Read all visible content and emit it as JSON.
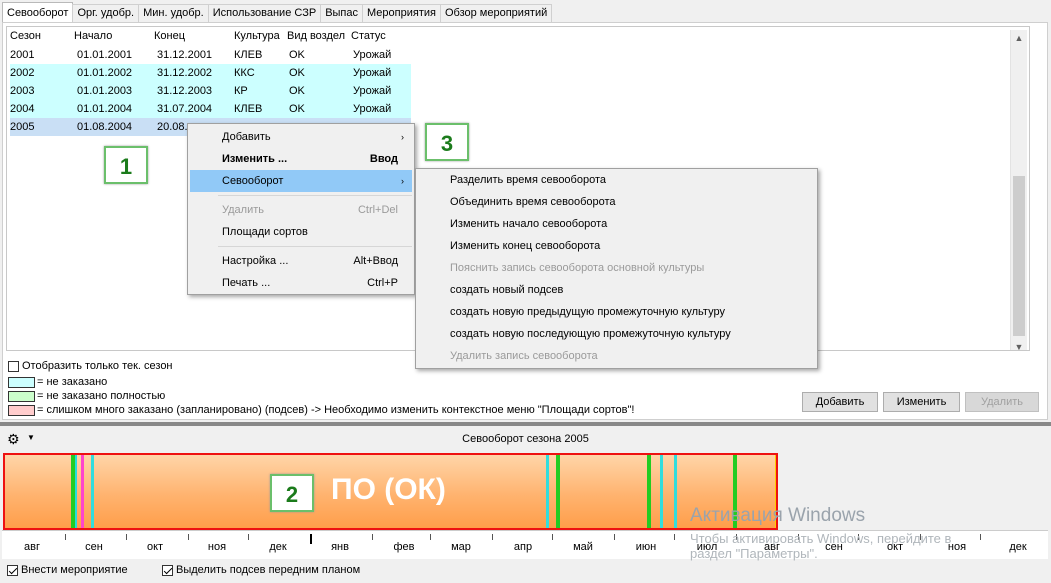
{
  "tabs": [
    {
      "label": "Севооборот"
    },
    {
      "label": "Орг. удобр."
    },
    {
      "label": "Мин. удобр."
    },
    {
      "label": "Использование СЗР"
    },
    {
      "label": "Выпас"
    },
    {
      "label": "Мероприятия"
    },
    {
      "label": "Обзор мероприятий"
    }
  ],
  "table": {
    "columns": [
      "Сезон",
      "Начало",
      "Конец",
      "Культура",
      "Вид воздел",
      "Статус"
    ],
    "rows": [
      {
        "season": "2001",
        "start": "01.01.2001",
        "end": "31.12.2001",
        "culture": "КЛЕВ",
        "type": "OK",
        "status": "Урожай"
      },
      {
        "season": "2002",
        "start": "01.01.2002",
        "end": "31.12.2002",
        "culture": "ККС",
        "type": "OK",
        "status": "Урожай"
      },
      {
        "season": "2003",
        "start": "01.01.2003",
        "end": "31.12.2003",
        "culture": "КР",
        "type": "OK",
        "status": "Урожай"
      },
      {
        "season": "2004",
        "start": "01.01.2004",
        "end": "31.07.2004",
        "culture": "КЛЕВ",
        "type": "OK",
        "status": "Урожай"
      },
      {
        "season": "2005",
        "start": "01.08.2004",
        "end": "20.08."
      }
    ]
  },
  "legend": {
    "only_current": "Отобразить только тек. сезон",
    "not_ordered": "= не заказано",
    "not_fully": "= не заказано полностью",
    "too_much": "= слишком много заказано (запланировано) (подсев) -> Необходимо изменить контекстное меню \"Площади сортов\"!",
    "colors": {
      "cyan": "#ccffff",
      "green": "#ccffcc",
      "pink": "#ffcccc"
    }
  },
  "buttons": {
    "add": "Добавить",
    "edit": "Изменить",
    "delete": "Удалить"
  },
  "timeline": {
    "title": "Севооборот сезона 2005",
    "label": "ПО (ОК)",
    "months": [
      "авг",
      "сен",
      "окт",
      "ноя",
      "дек",
      "янв",
      "фев",
      "мар",
      "апр",
      "май",
      "июн",
      "июл",
      "авг",
      "сен",
      "окт",
      "ноя",
      "дек"
    ]
  },
  "bottom": {
    "add_events": "Внести мероприятие",
    "highlight": "Выделить подсев передним планом"
  },
  "context_menu": {
    "items": [
      {
        "label": "Добавить",
        "shortcut": "",
        "submenu": true
      },
      {
        "label": "Изменить ...",
        "shortcut": "Ввод",
        "bold": true
      },
      {
        "label": "Севооборот",
        "shortcut": "",
        "submenu": true
      },
      {
        "label": "Удалить",
        "shortcut": "Ctrl+Del",
        "disabled": true
      },
      {
        "label": "Площади сортов",
        "shortcut": ""
      },
      {
        "label": "Настройка ...",
        "shortcut": "Alt+Ввод"
      },
      {
        "label": "Печать ...",
        "shortcut": "Ctrl+P"
      }
    ]
  },
  "submenu": {
    "items": [
      {
        "label": "Разделить время севооборота"
      },
      {
        "label": "Объединить время севооборота"
      },
      {
        "label": "Изменить начало севооборота"
      },
      {
        "label": "Изменить конец севооборота"
      },
      {
        "label": "Пояснить запись севооборота основной культуры",
        "disabled": true
      },
      {
        "label": "создать новый подсев"
      },
      {
        "label": "создать новую предыдущую промежуточную культуру"
      },
      {
        "label": "создать новую последующую промежуточную культуру"
      },
      {
        "label": "Удалить запись севооборота",
        "disabled": true
      }
    ]
  },
  "callouts": {
    "one": "1",
    "two": "2",
    "three": "3"
  },
  "watermark": {
    "line1": "Активация Windows",
    "line2": "Чтобы активировать Windows, перейдите в",
    "line3": "раздел \"Параметры\"."
  }
}
